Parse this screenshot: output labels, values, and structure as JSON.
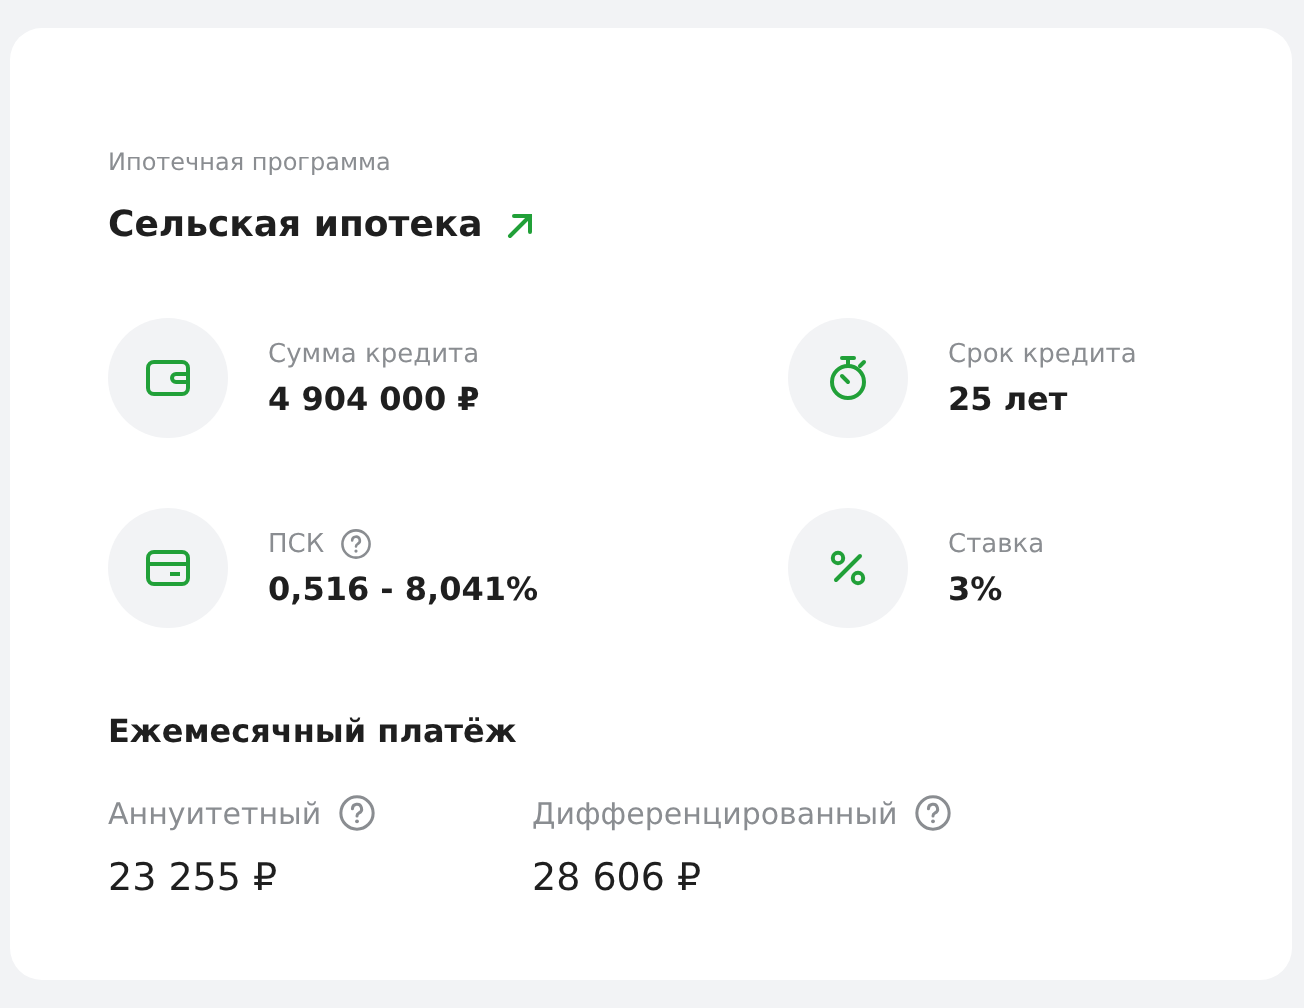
{
  "program": {
    "caption": "Ипотечная программа",
    "title": "Сельская ипотека"
  },
  "stats": [
    {
      "kind": "wallet",
      "label": "Сумма кредита",
      "value": "4 904 000 ₽",
      "help": false
    },
    {
      "kind": "stopwatch",
      "label": "Срок кредита",
      "value": "25 лет",
      "help": false
    },
    {
      "kind": "card",
      "label": "ПСК",
      "value": "0,516 - 8,041%",
      "help": true
    },
    {
      "kind": "percent",
      "label": "Ставка",
      "value": "3%",
      "help": false
    }
  ],
  "monthly_payment": {
    "heading": "Ежемесячный платёж",
    "options": [
      {
        "label": "Аннуитетный",
        "value": "23 255 ₽",
        "help": true
      },
      {
        "label": "Дифференцированный",
        "value": "28 606 ₽",
        "help": true
      }
    ]
  }
}
